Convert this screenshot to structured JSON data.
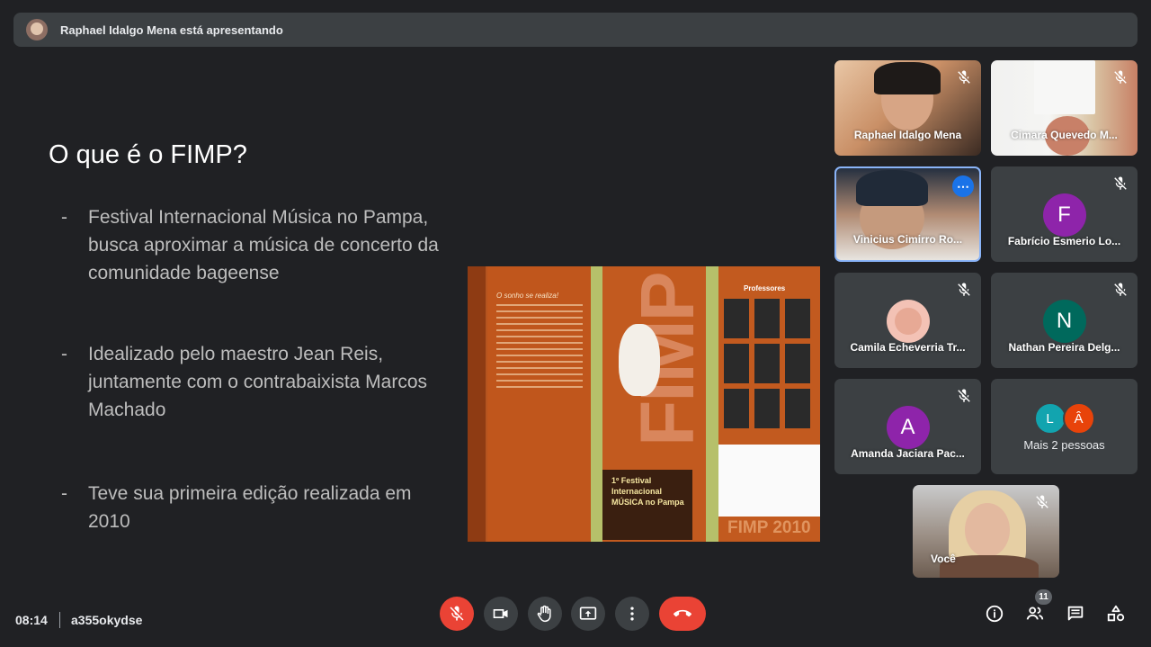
{
  "banner": {
    "text": "Raphael Idalgo Mena está apresentando"
  },
  "slide": {
    "title": "O que é o FIMP?",
    "bullets": [
      {
        "dash": "-",
        "text": "Festival Internacional Música no Pampa, busca aproximar a música de concerto da comunidade bageense"
      },
      {
        "dash": "-",
        "text": "Idealizado pelo maestro Jean Reis, juntamente com o contrabaixista Marcos Machado"
      },
      {
        "dash": "-",
        "text": "Teve sua primeira edição realizada em 2010"
      }
    ],
    "poster": {
      "heading": "O sonho se realiza!",
      "fimp": "FIMP",
      "festival": "1º Festival Internacional MÚSICA no Pampa",
      "professores": "Professores",
      "year_label": "FIMP 2010"
    }
  },
  "participants": [
    {
      "name": "Raphael Idalgo Mena",
      "muted": true
    },
    {
      "name": "Cimara Quevedo M...",
      "muted": true
    },
    {
      "name": "Vinicius Cimirro Ro...",
      "muted": false
    },
    {
      "name": "Fabrício Esmerio Lo...",
      "initial": "F",
      "avatar_color": "#8e24aa",
      "muted": true
    },
    {
      "name": "Camila Echeverria Tr...",
      "muted": true
    },
    {
      "name": "Nathan Pereira Delg...",
      "initial": "N",
      "avatar_color": "#00695c",
      "muted": true
    },
    {
      "name": "Amanda Jaciara Pac...",
      "initial": "A",
      "avatar_color": "#8e24aa",
      "muted": true
    },
    {
      "more": "Mais 2 pessoas",
      "avatars": [
        {
          "letter": "L",
          "color": "#12a4af"
        },
        {
          "letter": "Â",
          "color": "#e8430a"
        }
      ]
    },
    {
      "name": "Você",
      "muted": true
    }
  ],
  "bottom": {
    "time": "08:14",
    "meeting_code": "a355okydse",
    "people_count": "11"
  },
  "colors": {
    "accent": "#1a73e8",
    "danger": "#ea4335",
    "bg": "#202124",
    "tile": "#3c4043"
  }
}
